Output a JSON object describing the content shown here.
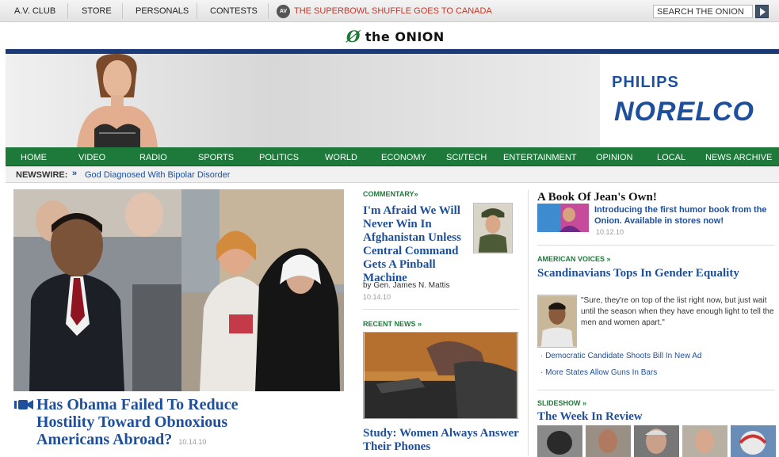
{
  "topnav": {
    "links": [
      "A.V. CLUB",
      "STORE",
      "PERSONALS",
      "CONTESTS"
    ],
    "av_badge": "AV",
    "promo": "THE SUPERBOWL SHUFFLE GOES TO CANADA",
    "search_placeholder": "SEARCH THE ONION"
  },
  "logo": {
    "mark": "Ø",
    "text": "the ONION"
  },
  "ad": {
    "brand": "PHILIPS",
    "product": "NORELCO"
  },
  "mainnav": [
    "HOME",
    "VIDEO",
    "RADIO",
    "SPORTS",
    "POLITICS",
    "WORLD",
    "ECONOMY",
    "SCI/TECH",
    "ENTERTAINMENT",
    "OPINION",
    "LOCAL",
    "NEWS ARCHIVE"
  ],
  "newswire": {
    "label": "NEWSWIRE:",
    "arrow": "»",
    "headline": "God Diagnosed With Bipolar Disorder"
  },
  "lead": {
    "headline_lines": [
      "Has Obama Failed To Reduce",
      "Hostility Toward Obnoxious",
      "Americans Abroad?"
    ],
    "date": "10.14.10"
  },
  "commentary": {
    "kicker": "COMMENTARY»",
    "headline": "I'm Afraid We Will Never Win In Afghanistan Unless Central Command Gets A Pinball Machine",
    "byline": "by Gen. James N. Mattis",
    "date": "10.14.10"
  },
  "recent": {
    "kicker": "RECENT NEWS »",
    "headline": "Study: Women Always Answer Their Phones"
  },
  "book": {
    "title": "A Book Of Jean's Own!",
    "blurb": "Introducing the first humor book from the Onion. Available in stores now!",
    "date": "10.12.10"
  },
  "american_voices": {
    "kicker": "AMERICAN VOICES »",
    "headline": "Scandinavians Tops In Gender Equality",
    "quote": "\"Sure, they're on top of the list right now, but just wait until the season when they have enough light to tell the men and women apart.\"",
    "links": [
      "Democratic Candidate Shoots Bill In New Ad",
      "More States Allow Guns In Bars"
    ]
  },
  "slideshow": {
    "kicker": "SLIDESHOW »",
    "title": "The Week In Review"
  }
}
